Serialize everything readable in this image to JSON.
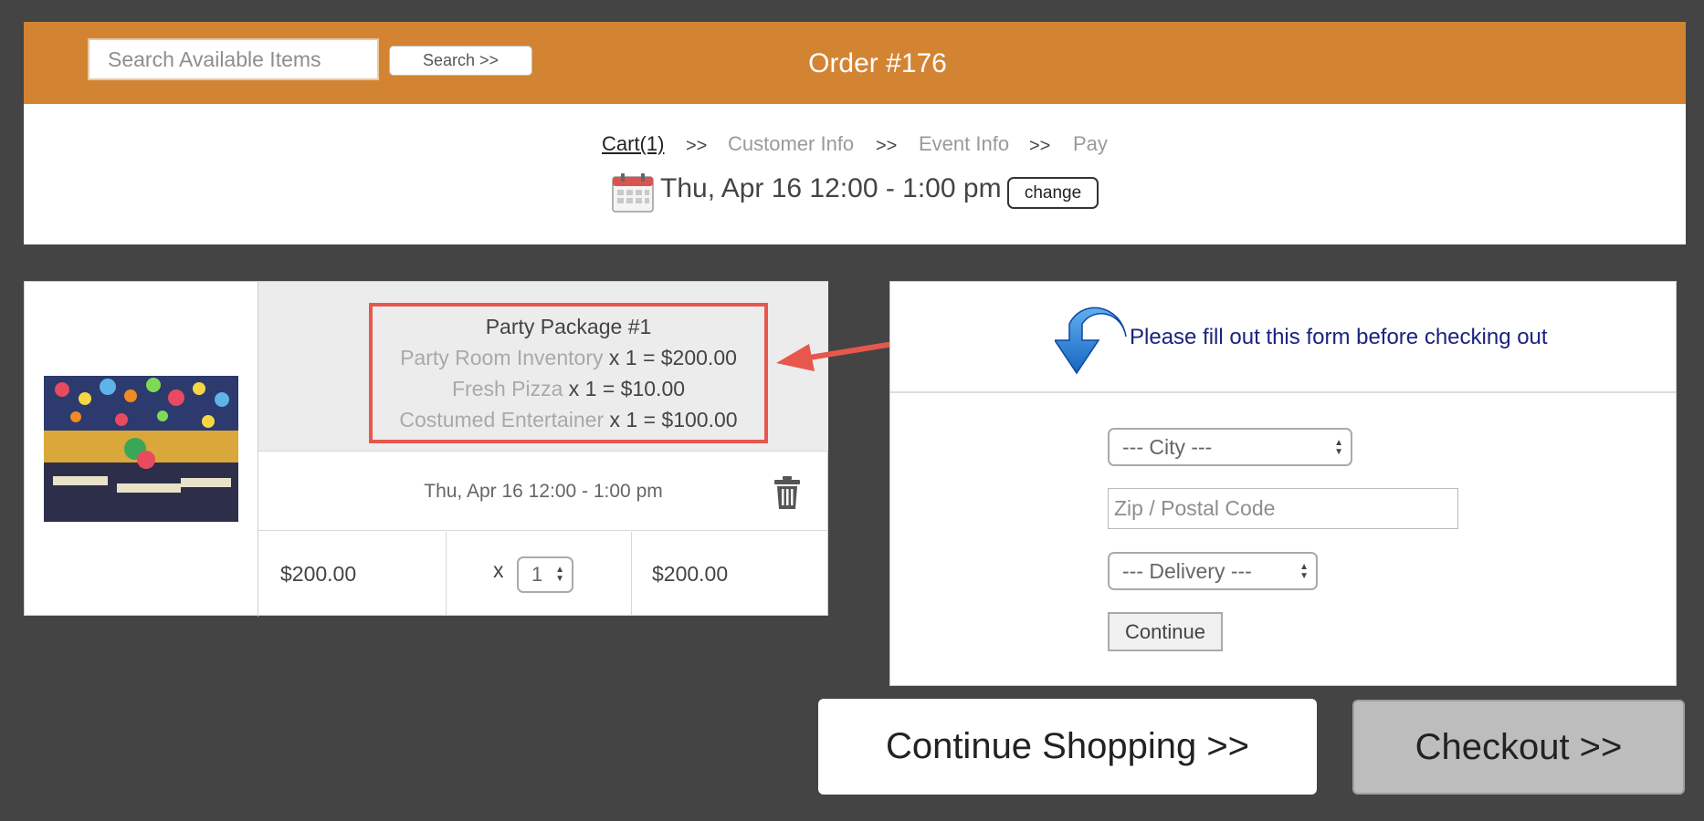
{
  "header": {
    "search_placeholder": "Search Available Items",
    "search_button": "Search >>",
    "order_title": "Order #176",
    "background_color": "#D38432"
  },
  "steps": {
    "cart": "Cart(1)",
    "separator": ">>",
    "customer_info": "Customer Info",
    "event_info": "Event Info",
    "pay": "Pay"
  },
  "event_time": {
    "text": "Thu, Apr 16 12:00 - 1:00 pm",
    "change_button": "change",
    "icon": "calendar-icon"
  },
  "cart_item": {
    "title": "Party Package #1",
    "lines": [
      {
        "name": "Party Room Inventory",
        "detail": " x 1 = $200.00"
      },
      {
        "name": "Fresh Pizza",
        "detail": " x 1 = $10.00"
      },
      {
        "name": "Costumed Entertainer",
        "detail": " x 1 = $100.00"
      }
    ],
    "date": "Thu, Apr 16 12:00 - 1:00 pm",
    "unit_price": "$200.00",
    "times": "x",
    "quantity": "1",
    "total": "$200.00",
    "highlight_color": "#E8574D"
  },
  "form": {
    "heading": "Please fill out this form before checking out",
    "city_placeholder": "--- City ---",
    "zip_placeholder": "Zip / Postal Code",
    "delivery_placeholder": "--- Delivery ---",
    "continue_button": "Continue"
  },
  "footer": {
    "continue_shopping": "Continue Shopping >>",
    "checkout": "Checkout >>"
  }
}
